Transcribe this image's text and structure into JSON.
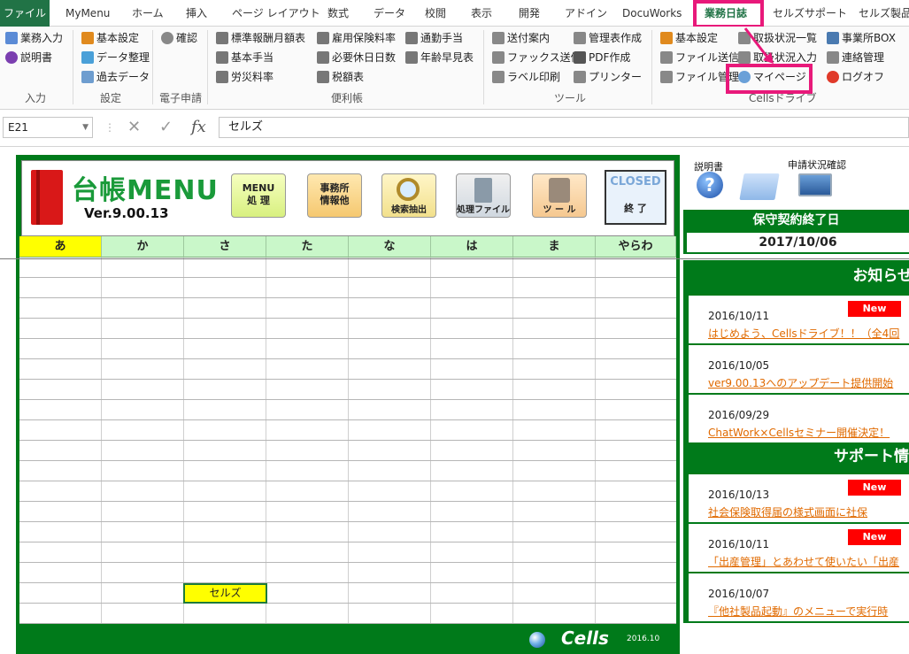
{
  "tabs": [
    {
      "label": "ファイル"
    },
    {
      "label": "MyMenu"
    },
    {
      "label": "ホーム"
    },
    {
      "label": "挿入"
    },
    {
      "label": "ページ レイアウト"
    },
    {
      "label": "数式"
    },
    {
      "label": "データ"
    },
    {
      "label": "校閲"
    },
    {
      "label": "表示"
    },
    {
      "label": "開発"
    },
    {
      "label": "アドイン"
    },
    {
      "label": "DocuWorks"
    },
    {
      "label": "業務日誌"
    },
    {
      "label": "セルズサポート"
    },
    {
      "label": "セルズ製品"
    }
  ],
  "ribbon": {
    "input": {
      "items": [
        "業務入力",
        "説明書"
      ],
      "label": "入力"
    },
    "settings": {
      "items": [
        "基本設定",
        "データ整理",
        "過去データ"
      ],
      "label": "設定"
    },
    "eapp": {
      "items": [
        "確認"
      ],
      "label": "電子申請"
    },
    "tools1": {
      "items": [
        "標準報酬月額表",
        "基本手当",
        "労災料率",
        "雇用保険料率",
        "必要休日日数",
        "税額表",
        "通勤手当",
        "年齢早見表"
      ],
      "label": "便利帳"
    },
    "tools2": {
      "items": [
        "送付案内",
        "ファックス送信",
        "ラベル印刷",
        "管理表作成",
        "PDF作成",
        "プリンター"
      ],
      "label": "ツール"
    },
    "drive": {
      "items": [
        "基本設定",
        "ファイル送信",
        "ファイル管理",
        "取扱状況一覧",
        "取扱状況入力",
        "マイページ",
        "事業所BOX",
        "連絡管理",
        "ログオフ"
      ],
      "label": "Cellsドライブ"
    }
  },
  "formula": {
    "namebox": "E21",
    "value": "セルズ",
    "cancel": "✕",
    "enter": "✓",
    "fx": "fx"
  },
  "menu": {
    "logo": "台帳MENU",
    "version": "Ver.9.00.13",
    "buttons": [
      {
        "label": "MENU\n処 理"
      },
      {
        "label": "事務所\n情報他"
      },
      {
        "label": "検索抽出"
      },
      {
        "label": "処理ファイル"
      },
      {
        "label": "ツ ー ル"
      }
    ],
    "closed_top": "CLOSED",
    "closed_bottom": "終 了",
    "kana": [
      "あ",
      "か",
      "さ",
      "た",
      "な",
      "は",
      "ま",
      "やらわ"
    ],
    "selected_cell": "セルズ",
    "brand": "Cells",
    "brand_date": "2016.10"
  },
  "right": {
    "manual": "説明書",
    "status_check": "申請状況確認",
    "maint_title": "保守契約終了日",
    "maint_date": "2017/10/06",
    "notice_title": "お知らせ",
    "support_title": "サポート情",
    "notices": [
      {
        "date": "2016/10/11",
        "new": "New",
        "text": "はじめよう、Cellsドライブ！！（全4回"
      },
      {
        "date": "2016/10/05",
        "new": "",
        "text": "ver9.00.13へのアップデート提供開始"
      },
      {
        "date": "2016/09/29",
        "new": "",
        "text": "ChatWork×Cellsセミナー開催決定！"
      }
    ],
    "support": [
      {
        "date": "2016/10/13",
        "new": "New",
        "text": "社会保険取得届の様式画面に社保"
      },
      {
        "date": "2016/10/11",
        "new": "New",
        "text": "「出産管理」とあわせて使いたい「出産"
      },
      {
        "date": "2016/10/07",
        "new": "",
        "text": "『他社製品起動』のメニューで実行時"
      }
    ]
  },
  "colors": {
    "excel_green": "#217346",
    "panel_green": "#007a1a",
    "highlight": "#e8197a",
    "new_badge": "#ff0000",
    "link": "#e06a00"
  }
}
